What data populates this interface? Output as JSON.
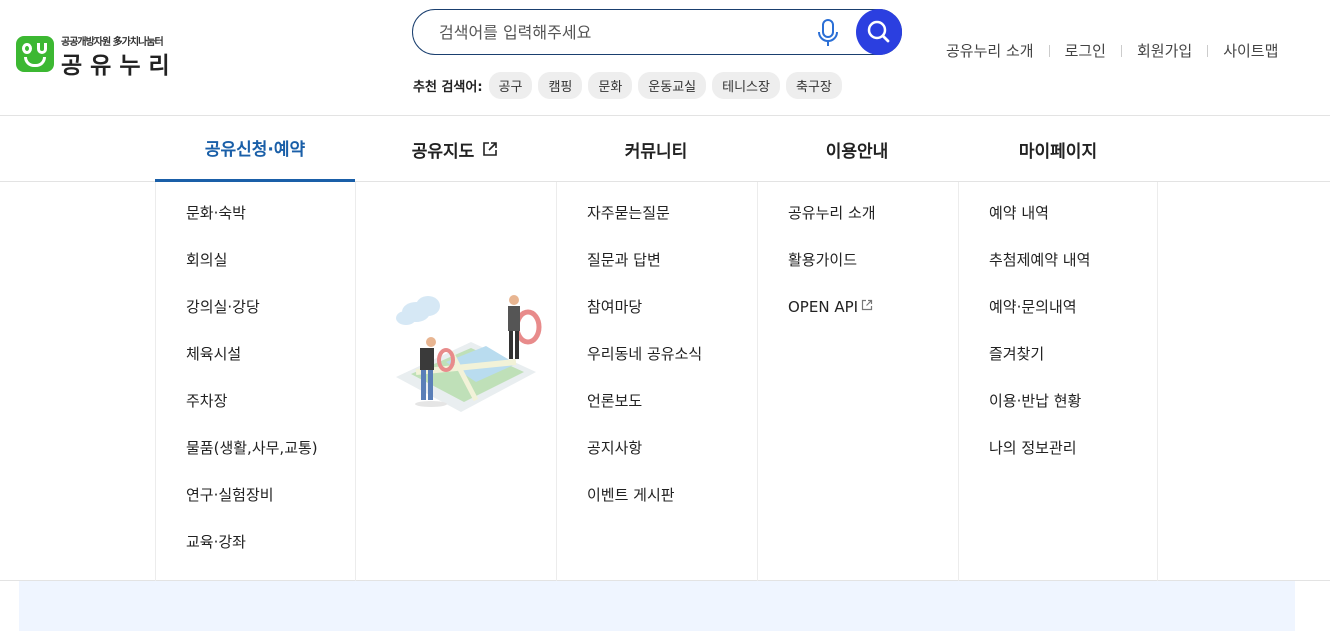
{
  "header": {
    "logo_sub": "공공개방자원 多가치나눔터",
    "logo_main": "공유누리",
    "search": {
      "placeholder": "검색어를 입력해주세요",
      "value": ""
    },
    "recommend_label": "추천 검색어:",
    "recommend_tags": [
      "공구",
      "캠핑",
      "문화",
      "운동교실",
      "테니스장",
      "축구장"
    ],
    "util_links": [
      "공유누리 소개",
      "로그인",
      "회원가입",
      "사이트맵"
    ]
  },
  "gnb": {
    "items": [
      {
        "label": "공유신청·예약",
        "active": true
      },
      {
        "label": "공유지도",
        "external": true
      },
      {
        "label": "커뮤니티"
      },
      {
        "label": "이용안내"
      },
      {
        "label": "마이페이지"
      }
    ]
  },
  "menu": {
    "reservation": [
      "문화·숙박",
      "회의실",
      "강의실·강당",
      "체육시설",
      "주차장",
      "물품(생활,사무,교통)",
      "연구·실험장비",
      "교육·강좌"
    ],
    "community": [
      "자주묻는질문",
      "질문과 답변",
      "참여마당",
      "우리동네 공유소식",
      "언론보도",
      "공지사항",
      "이벤트 게시판"
    ],
    "guide": [
      "공유누리 소개",
      "활용가이드",
      "OPEN API"
    ],
    "mypage": [
      "예약 내역",
      "추첨제예약 내역",
      "예약·문의내역",
      "즐겨찾기",
      "이용·반납 현황",
      "나의 정보관리"
    ]
  },
  "colors": {
    "brand_green": "#3cb832",
    "search_blue": "#2b3fe0",
    "active_blue": "#1a5fa8",
    "band_bg": "#eff5ff"
  },
  "icons": {
    "mic": "microphone-icon",
    "search": "magnifier-icon",
    "external": "external-link-icon"
  }
}
